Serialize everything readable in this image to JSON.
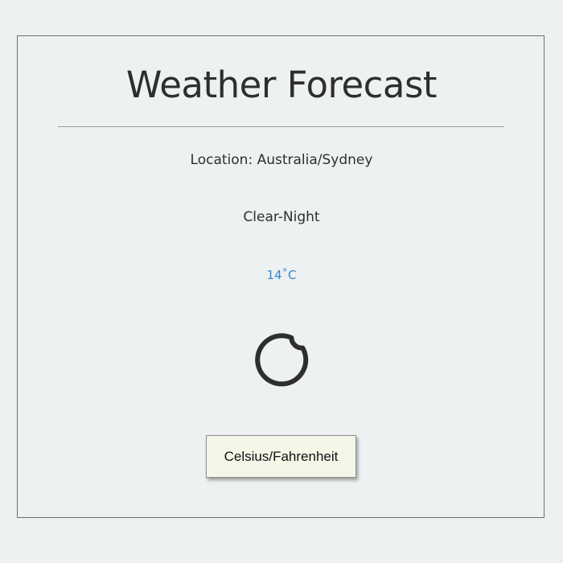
{
  "page": {
    "title": "Weather Forecast"
  },
  "weather": {
    "location": "Location: Australia/Sydney",
    "condition": "Clear-Night",
    "temperature": "14˚C",
    "icon": "moon-icon"
  },
  "controls": {
    "toggle_label": "Celsius/Fahrenheit"
  },
  "colors": {
    "background": "#eef1f2",
    "text": "#2e2e2e",
    "temperature": "#3a86c8",
    "button_bg": "#f4f6e8"
  }
}
